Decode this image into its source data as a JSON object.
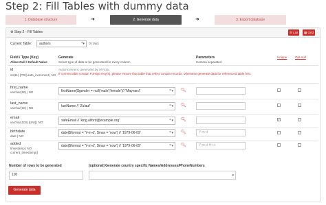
{
  "title": "Step 2: Fill Tables with dummy data",
  "steps": [
    {
      "label": "1. Database structure"
    },
    {
      "label": "2. Generate data"
    },
    {
      "label": "3. Export database"
    }
  ],
  "arrows": [
    "➜",
    "➜"
  ],
  "panel": {
    "title": "Step 2 - Fill Tables",
    "list_button": "List",
    "grid_button": "Grid"
  },
  "table_select": {
    "label": "Current Table:",
    "value": "authors",
    "clear": "×",
    "rows": "0 rows"
  },
  "columns": {
    "field_type": "Field / Type (Key)",
    "field_type_sub": "Allow Null / Default Value",
    "generate": "Generate",
    "generate_sub": "Select type of data to be generated for every column",
    "parameters": "Parameters",
    "parameters_sub": "Comma separated",
    "unique": "Unique",
    "optnull": "Opt-null"
  },
  "fields": [
    {
      "name": "id",
      "type": "int(11) [PRI] auto_increment",
      "null": "| NO",
      "gen_note": "Autoincrement, generated by MYSQL",
      "gen_warning": "If current table contain Foreign Key(s), please ensure that table that refers contain records, otherwise generate data for referenced table first."
    },
    {
      "name": "first_name",
      "type": "varchar(50) | NO",
      "generator": "firstName($gender = null('male'|'female')// 'Maynard'",
      "param": "",
      "unique": false
    },
    {
      "name": "last_name",
      "type": "varchar(50) | NO",
      "generator": "lastName // 'Zulauf'",
      "param": "",
      "unique": false
    },
    {
      "name": "email",
      "type": "varchar(100) [UNI] | NO",
      "generator": "safeEmail // 'king.alford@example.org'",
      "param": "",
      "unique": true
    },
    {
      "name": "birthdate",
      "type": "date | NO",
      "generator": "date($format = 'Y-m-d', $max = 'now') // '1979-06-09'",
      "param": "Y-m-d",
      "unique": false
    },
    {
      "name": "added",
      "type": "timestamp | NO",
      "type2": "current_timestamp()",
      "generator": "date($format = 'Y-m-d', $max = 'now') // '1979-06-09'",
      "param": "Y-m-d H:i:s",
      "unique": false
    }
  ],
  "bottom": {
    "rows_label": "Number of rows to be generated",
    "rows_value": "100",
    "country_label": "[optional] Generate country specific Names/Addresses/PhoneNumbers",
    "generate_button": "Generate data"
  },
  "colors": {
    "accent": "#c9302c",
    "dark_step": "#555555",
    "step_bg": "#f2dede"
  },
  "icons": {
    "search": "search-icon",
    "clear": "close-icon",
    "caret": "chevron-down-icon"
  }
}
